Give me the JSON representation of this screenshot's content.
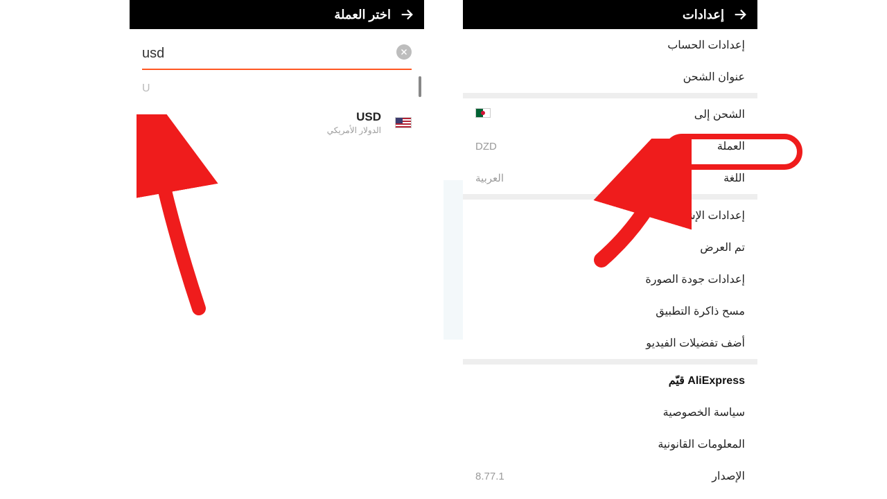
{
  "left": {
    "title": "اختر العملة",
    "search_value": "usd",
    "section_letter": "U",
    "currency": {
      "code": "USD",
      "name": "الدولار الأمريكي"
    }
  },
  "right": {
    "title": "إعدادات",
    "items": {
      "account": "إعدادات الحساب",
      "shipping_addr": "عنوان الشحن",
      "ship_to": "الشحن إلى",
      "currency_label": "العملة",
      "currency_value": "DZD",
      "language_label": "اللغة",
      "language_value": "العربية",
      "notifications": "إعدادات الإشعارات",
      "viewed": "تم العرض",
      "image_quality": "إعدادات جودة الصورة",
      "clear_cache": "مسح ذاكرة التطبيق",
      "video_prefs": "أضف تفضيلات الفيديو",
      "rate": "قيّم AliExpress",
      "privacy": "سياسة الخصوصية",
      "legal": "المعلومات القانونية",
      "version_label": "الإصدار",
      "version_value": "8.77.1"
    }
  }
}
